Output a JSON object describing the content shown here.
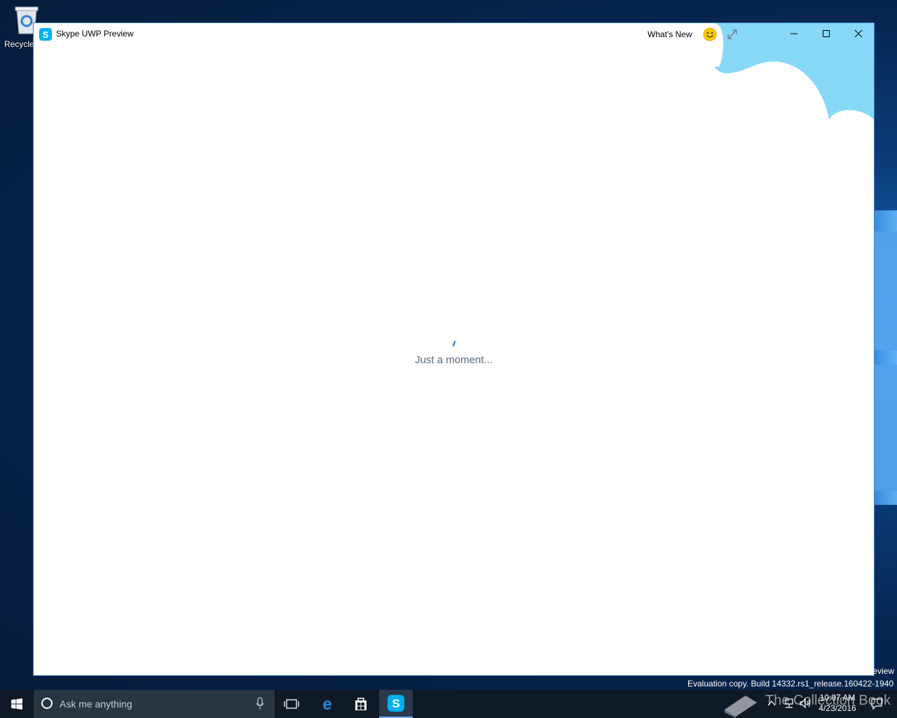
{
  "desktop": {
    "recycle_bin_label": "Recycle",
    "watermark_fragment": "eview",
    "evaluation_text": "Evaluation copy. Build 14332.rs1_release.160422-1940",
    "collection_text": "The Collection Book"
  },
  "window": {
    "title": "Skype UWP Preview",
    "whats_new_label": "What's New",
    "loading_text": "Just a moment...",
    "accent_color": "#0078d7",
    "sky_color": "#87d8f7"
  },
  "taskbar": {
    "search_placeholder": "Ask me anything",
    "time": "10:07 AM",
    "date": "4/23/2016",
    "apps": [
      "task-view",
      "edge",
      "store",
      "skype"
    ]
  }
}
